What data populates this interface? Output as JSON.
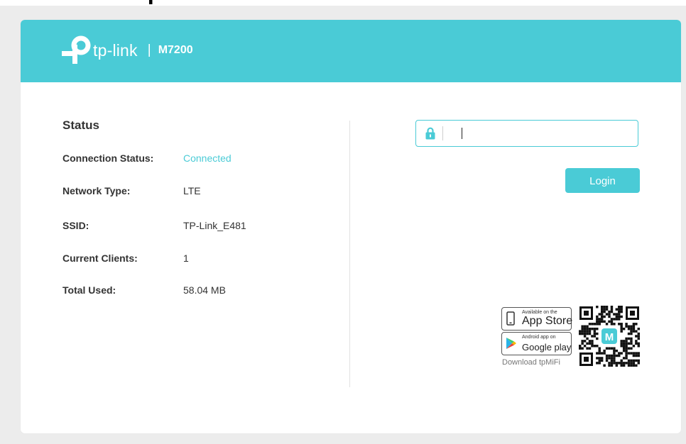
{
  "header": {
    "brand": "tp-link",
    "separator": "|",
    "model": "M7200",
    "background_color": "#4acbd6"
  },
  "status": {
    "title": "Status",
    "rows": [
      {
        "label": "Connection Status:",
        "value": "Connected"
      },
      {
        "label": "Network Type:",
        "value": "LTE"
      },
      {
        "label": "SSID:",
        "value": "TP-Link_E481"
      },
      {
        "label": "Current Clients:",
        "value": "1"
      },
      {
        "label": "Total Used:",
        "value": "58.04 MB"
      }
    ],
    "connected_color": "#4acbd6"
  },
  "login": {
    "password_value": "",
    "button_label": "Login",
    "icon": "lock-icon"
  },
  "app": {
    "appstore_small": "Available on the",
    "appstore_big": "App Store",
    "gplay_small": "Android app on",
    "gplay_big": "Google play",
    "download_label": "Download tpMiFi",
    "qr_center_letter": "M"
  },
  "colors": {
    "accent": "#4acbd6",
    "text": "#333333",
    "page_background": "#ececec"
  }
}
